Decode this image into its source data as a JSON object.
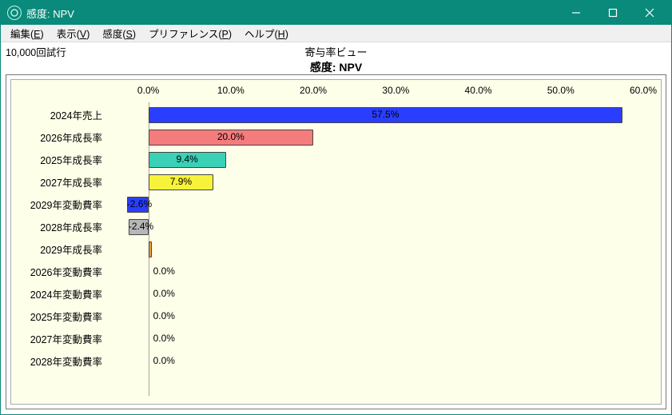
{
  "window": {
    "title": "感度: NPV",
    "buttons": {
      "minimize": "−",
      "maximize": "□",
      "close": "×"
    }
  },
  "menu": [
    {
      "label": "編集",
      "mn": "E"
    },
    {
      "label": "表示",
      "mn": "V"
    },
    {
      "label": "感度",
      "mn": "S"
    },
    {
      "label": "プリファレンス",
      "mn": "P"
    },
    {
      "label": "ヘルプ",
      "mn": "H"
    }
  ],
  "trials_label": "10,000回試行",
  "chart_header": "寄与率ビュー",
  "chart_title": "感度: NPV",
  "chart_data": {
    "type": "bar",
    "orientation": "horizontal",
    "title": "感度: NPV",
    "subtitle": "寄与率ビュー",
    "xlabel": "",
    "ylabel": "",
    "xlim": [
      -5,
      60
    ],
    "x_ticks": [
      0,
      10,
      20,
      30,
      40,
      50,
      60
    ],
    "x_tick_labels": [
      "0.0%",
      "10.0%",
      "20.0%",
      "30.0%",
      "40.0%",
      "50.0%",
      "60.0%"
    ],
    "categories": [
      "2024年売上",
      "2026年成長率",
      "2025年成長率",
      "2027年成長率",
      "2029年変動費率",
      "2028年成長率",
      "2029年成長率",
      "2026年変動費率",
      "2024年変動費率",
      "2025年変動費率",
      "2027年変動費率",
      "2028年変動費率"
    ],
    "values": [
      57.5,
      20.0,
      9.4,
      7.9,
      -2.6,
      -2.4,
      0.2,
      0.0,
      0.0,
      0.0,
      0.0,
      0.0
    ],
    "data_labels": [
      "57.5%",
      "20.0%",
      "9.4%",
      "7.9%",
      "-2.6%",
      "-2.4%",
      "",
      "0.0%",
      "0.0%",
      "0.0%",
      "0.0%",
      "0.0%"
    ],
    "colors": [
      "#2a3eff",
      "#f47c7c",
      "#3ad1b7",
      "#f7f33a",
      "#2a3eff",
      "#b7b7b7",
      "#f59b3a",
      "",
      "",
      "",
      "",
      ""
    ]
  }
}
